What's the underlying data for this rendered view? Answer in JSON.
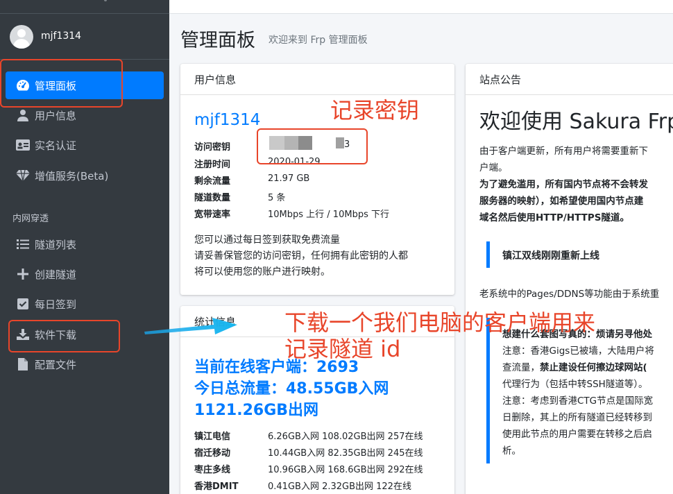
{
  "sidebar": {
    "username": "mjf1314",
    "nav_items": [
      {
        "label": "管理面板"
      },
      {
        "label": "用户信息"
      },
      {
        "label": "实名认证"
      },
      {
        "label": "增值服务(Beta)"
      }
    ],
    "section_header": "内网穿透",
    "tunnel_items": [
      {
        "label": "隧道列表"
      },
      {
        "label": "创建隧道"
      },
      {
        "label": "每日签到"
      },
      {
        "label": "软件下载"
      },
      {
        "label": "配置文件"
      }
    ]
  },
  "header": {
    "title": "管理面板",
    "subtitle": "欢迎来到 Frp 管理面板"
  },
  "user_card": {
    "title": "用户信息",
    "username": "mjf1314",
    "rows": [
      {
        "key": "访问密钥",
        "value": "3"
      },
      {
        "key": "注册时间",
        "value": "2020-01-29"
      },
      {
        "key": "剩余流量",
        "value": "21.97 GB"
      },
      {
        "key": "隧道数量",
        "value": "5 条"
      },
      {
        "key": "宽带速率",
        "value": "10Mbps 上行 / 10Mbps 下行"
      }
    ],
    "note1": "您可以通过每日签到获取免费流量",
    "note2a": "请妥善保管您的访问密钥，任何拥有此密钥的人都",
    "note2b": "将可以使用您的账户进行映射。"
  },
  "stats_card": {
    "title": "统计信息",
    "online": "当前在线客户端：2693",
    "traffic_in": "今日总流量：48.55GB入网",
    "traffic_out": "1121.26GB出网",
    "nodes": [
      {
        "name": "镇江电信",
        "value": "6.26GB入网 108.02GB出网 257在线"
      },
      {
        "name": "宿迁移动",
        "value": "10.44GB入网 82.35GB出网 245在线"
      },
      {
        "name": "枣庄多线",
        "value": "10.96GB入网 168.6GB出网 292在线"
      },
      {
        "name": "香港DMIT",
        "value": "0.41GB入网 2.32GB出网 122在线"
      }
    ]
  },
  "announce_card": {
    "title": "站点公告",
    "heading": "欢迎使用 Sakura Frp",
    "p1a": "由于客户端更新，所有用户将需要重新下",
    "p1b": "户端。",
    "p2a": "为了避免滥用，所有国内节点将不会转发",
    "p2b": "服务器的映射），如希望使用国内节点建",
    "p2c": "域名然后使用HTTP/HTTPS隧道。",
    "callout": "镇江双线刚刚重新上线",
    "p3": "老系统中的Pages/DDNS等功能由于系统重",
    "c_l1": "想建什么套图写真的：烦请另寻他处",
    "c_l2": "注意：香港Gigs已被墙，大陆用户将",
    "c_l3a": "查流量，",
    "c_l3b": "禁止建设任何擦边球网站(",
    "c_l4": "代理行为（包括中转SSH隧道等）。",
    "c_l5": "注意：考虑到香港CTG节点是国际宽",
    "c_l6": "日删除，其上的所有隧道已经转移到",
    "c_l7": "使用此节点的用户需要在转移之后启",
    "c_l8": "析。"
  },
  "annotations": {
    "record_key": "记录密钥",
    "download_line1": "下载一个我们电脑的客户端用来",
    "download_line2": "记录隧道 id",
    "color": "#e8452a",
    "arrow_color": "#1aa3e8"
  }
}
